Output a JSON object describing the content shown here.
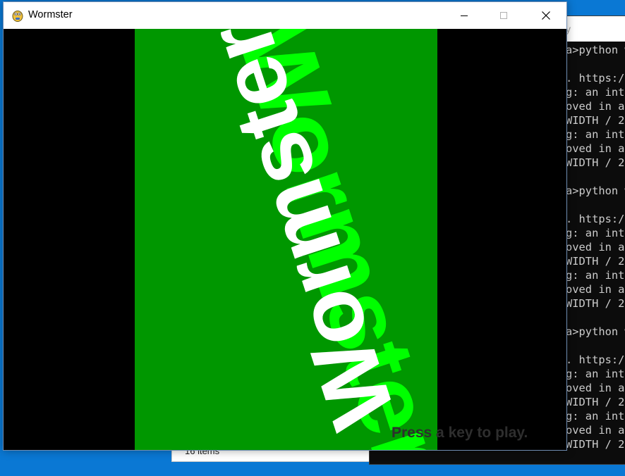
{
  "explorer": {
    "status": "16 items"
  },
  "console": {
    "title_tail": "y",
    "lines": [
      "a>python w",
      "",
      ". https:/",
      "g: an inte",
      "oved in a",
      "WIDTH / 2",
      "g: an inte",
      "oved in a",
      "WIDTH / 2",
      "",
      "a>python w",
      "",
      ". https:/",
      "g: an inte",
      "oved in a",
      "WIDTH / 2",
      "g: an inte",
      "oved in a",
      "WIDTH / 2",
      "",
      "a>python w",
      "",
      ". https:/",
      "g: an inte",
      "oved in a",
      "WIDTH / 2",
      "g: an inte",
      "oved in a",
      "WIDTH / 2"
    ]
  },
  "window": {
    "title": "Wormster",
    "icon": "pygame-snake-icon",
    "controls": [
      "minimize-icon",
      "maximize-icon",
      "close-icon"
    ]
  },
  "game": {
    "title_text": "Wormster",
    "subtitle_text": "Wormster!",
    "prompt": "Press a key to play.",
    "colors": {
      "background": "#000000",
      "panel": "#009700",
      "title": "#00ff00",
      "subtitle": "#ffffff",
      "prompt": "#2e2e2e"
    }
  }
}
